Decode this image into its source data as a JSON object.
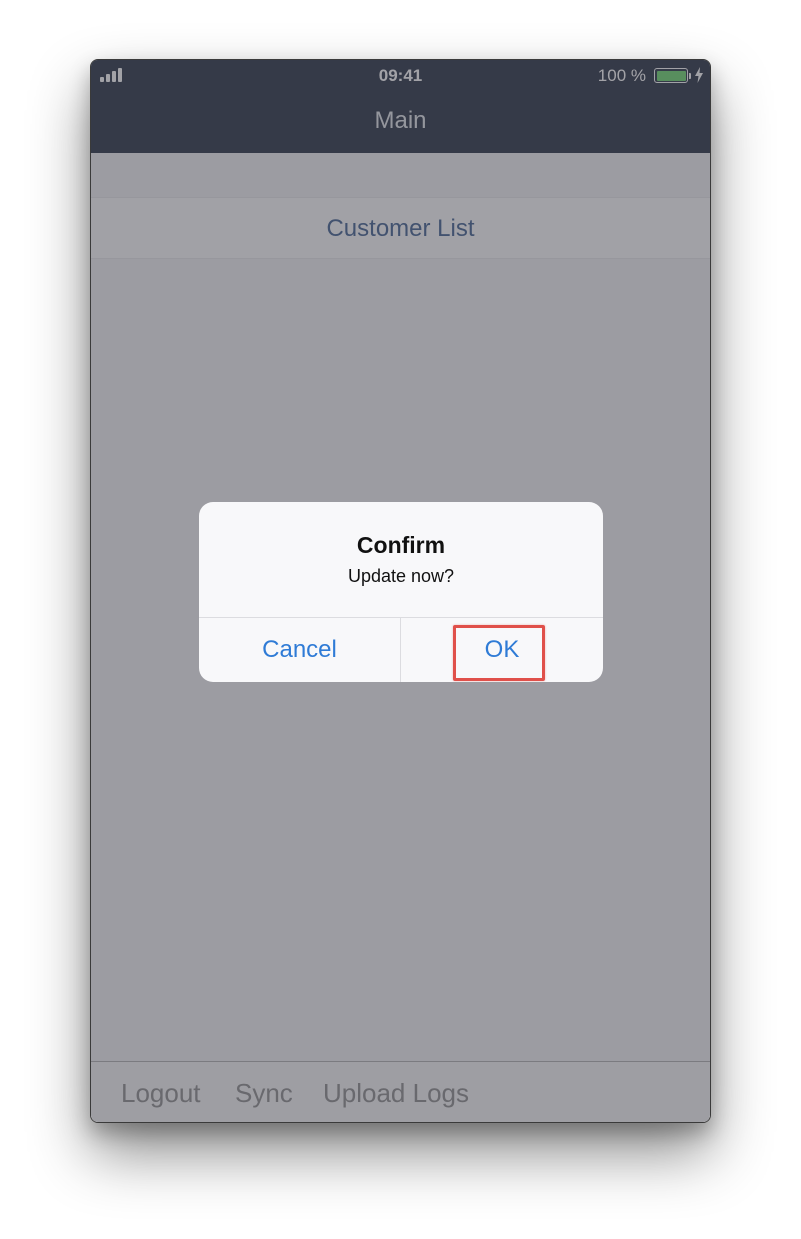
{
  "status_bar": {
    "time": "09:41",
    "battery_percent": "100 %",
    "battery_level": 1.0,
    "battery_color": "#6bd66d"
  },
  "nav": {
    "title": "Main",
    "background": "#252f40"
  },
  "content": {
    "list_items": [
      {
        "label": "Customer List"
      }
    ]
  },
  "toolbar": {
    "items": [
      {
        "label": "Logout"
      },
      {
        "label": "Sync"
      },
      {
        "label": "Upload Logs"
      }
    ]
  },
  "dialog": {
    "title": "Confirm",
    "message": "Update now?",
    "cancel_label": "Cancel",
    "ok_label": "OK",
    "accent_color": "#2f7bd6",
    "highlight_color": "#e0504a",
    "highlighted_button": "OK"
  }
}
